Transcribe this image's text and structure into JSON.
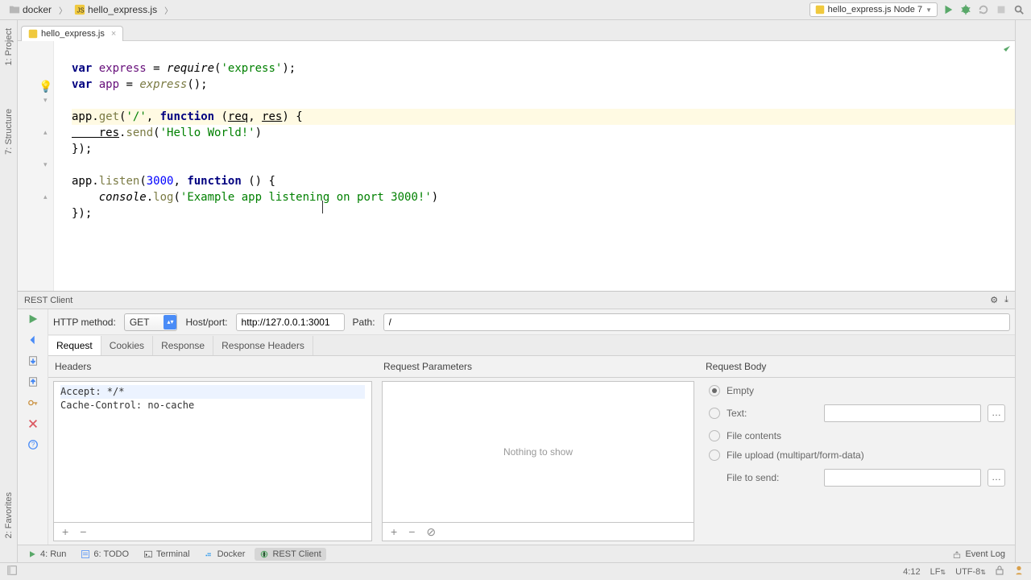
{
  "breadcrumb": {
    "folder": "docker",
    "file": "hello_express.js"
  },
  "run_config": "hello_express.js Node 7",
  "editor_tab": "hello_express.js",
  "code": {
    "l1": {
      "a": "var ",
      "b": "express",
      "c": " = ",
      "d": "require",
      "e": "(",
      "f": "'express'",
      "g": ");"
    },
    "l2": {
      "a": "var ",
      "b": "app",
      "c": " = ",
      "d": "express",
      "e": "();"
    },
    "l3": {
      "a": "app",
      "b": ".",
      "c": "get",
      "d": "(",
      "e": "'/'",
      "f": ", ",
      "g": "function ",
      "h": "(",
      "i": "req",
      "j": ", ",
      "k": "res",
      "l": ") {"
    },
    "l4": {
      "a": "    res",
      "b": ".",
      "c": "send",
      "d": "(",
      "e": "'Hello World!'",
      "f": ")"
    },
    "l5": "});",
    "l6": {
      "a": "app",
      "b": ".",
      "c": "listen",
      "d": "(",
      "e": "3000",
      "f": ", ",
      "g": "function ",
      "h": "() {"
    },
    "l7": {
      "a": "    console",
      "b": ".",
      "c": "log",
      "d": "(",
      "e": "'Example app listening on port 3000!'",
      "f": ")"
    },
    "l8": "});"
  },
  "side_tabs": {
    "project": "1: Project",
    "structure": "7: Structure",
    "favorites": "2: Favorites"
  },
  "rest": {
    "title": "REST Client",
    "http_method_label": "HTTP method:",
    "http_method": "GET",
    "host_label": "Host/port:",
    "host": "http://127.0.0.1:3001",
    "path_label": "Path:",
    "path": "/",
    "tabs": {
      "request": "Request",
      "cookies": "Cookies",
      "response": "Response",
      "response_headers": "Response Headers"
    },
    "headers": {
      "title": "Headers",
      "l1": "Accept: */*",
      "l2": "Cache-Control: no-cache"
    },
    "params": {
      "title": "Request Parameters",
      "empty": "Nothing to show"
    },
    "body": {
      "title": "Request Body",
      "empty": "Empty",
      "text": "Text:",
      "file_contents": "File contents",
      "file_upload": "File upload (multipart/form-data)",
      "file_to_send": "File to send:"
    }
  },
  "bottom": {
    "run": "4: Run",
    "todo": "6: TODO",
    "terminal": "Terminal",
    "docker": "Docker",
    "rest": "REST Client",
    "event_log": "Event Log"
  },
  "status": {
    "pos": "4:12",
    "sep": "LF",
    "enc": "UTF-8"
  }
}
